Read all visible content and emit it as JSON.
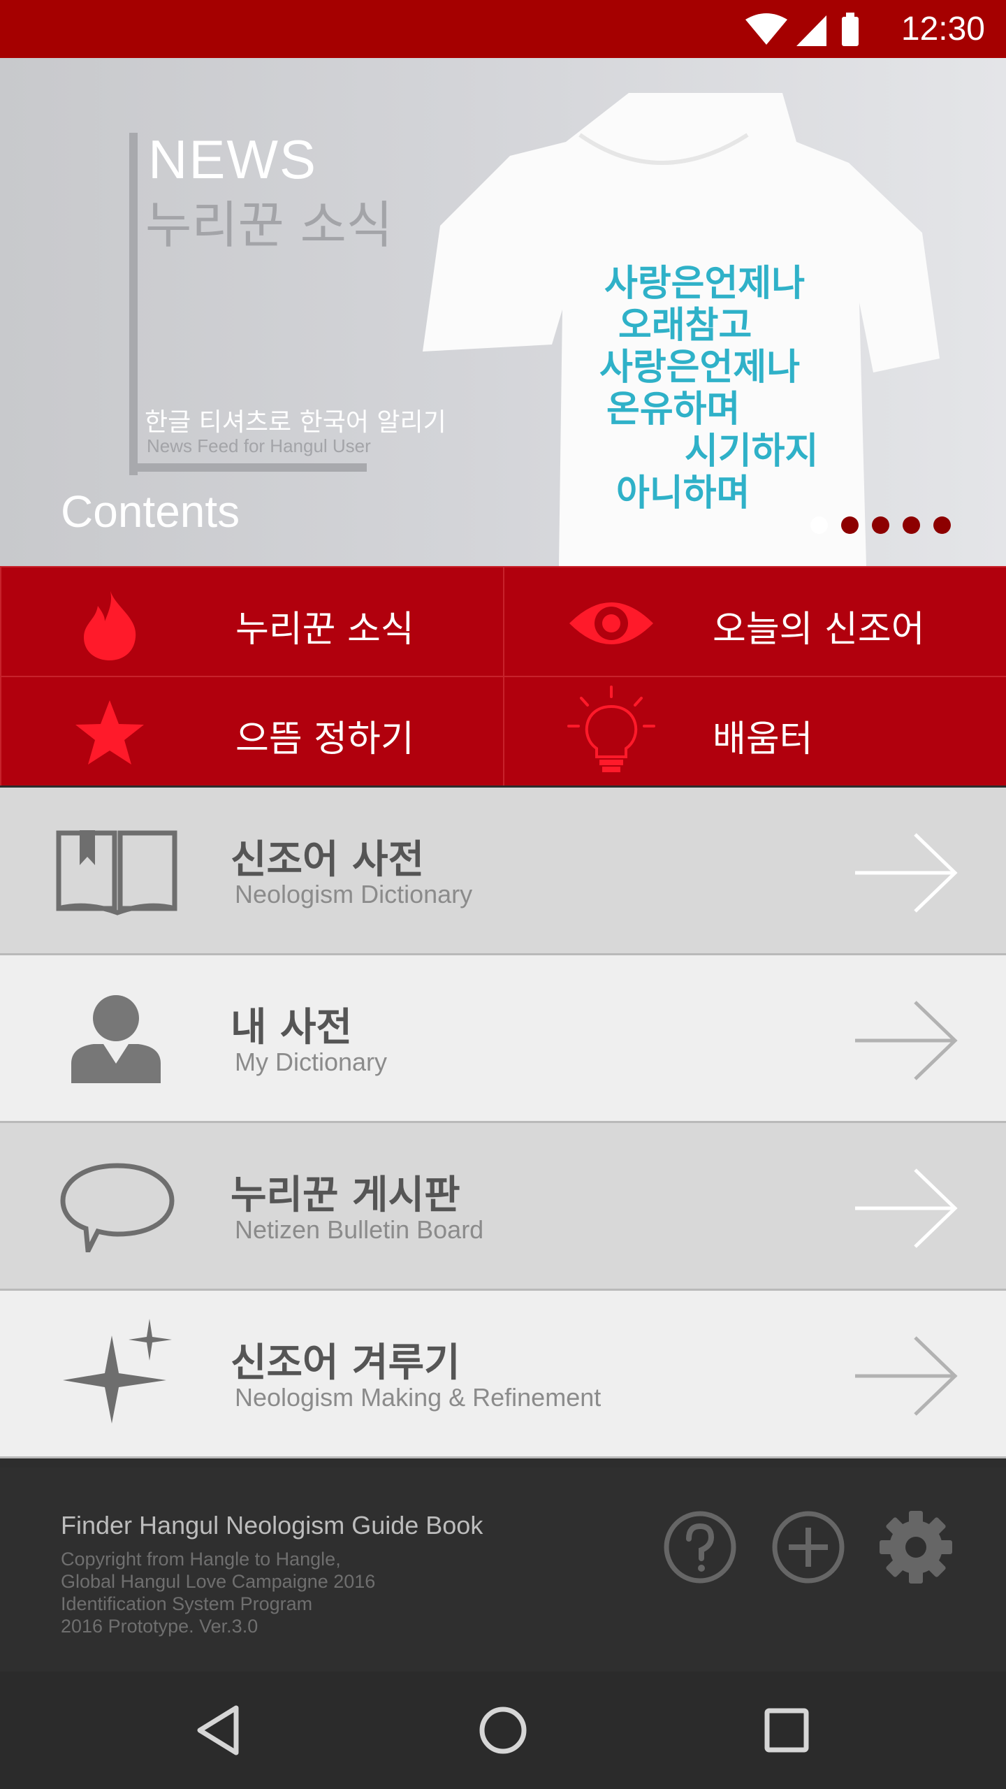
{
  "status_bar": {
    "time": "12:30",
    "icons": [
      "wifi-icon",
      "signal-icon",
      "battery-icon"
    ]
  },
  "hero": {
    "news_en": "NEWS",
    "news_ko": "누리꾼 소식",
    "caption_ko": "한글 티셔츠로 한국어 알리기",
    "caption_en": "News Feed for Hangul User",
    "section_label": "Contents",
    "carousel_dots": 5,
    "carousel_active_index": 0,
    "shirt_lettering": [
      "사랑은언제나",
      "오래참고",
      "사랑은언제나",
      "온유하며",
      "시기하지",
      "아니하며"
    ]
  },
  "quick_menu": [
    {
      "label": "누리꾼 소식",
      "icon": "flame-icon"
    },
    {
      "label": "오늘의 신조어",
      "icon": "eye-icon"
    },
    {
      "label": "으뜸 정하기",
      "icon": "star-icon"
    },
    {
      "label": "배움터",
      "icon": "lightbulb-icon"
    }
  ],
  "menu_list": [
    {
      "title_ko": "신조어 사전",
      "title_en": "Neologism Dictionary",
      "icon": "book-icon"
    },
    {
      "title_ko": "내 사전",
      "title_en": "My Dictionary",
      "icon": "person-icon"
    },
    {
      "title_ko": "누리꾼 게시판",
      "title_en": "Netizen Bulletin Board",
      "icon": "speech-bubble-icon"
    },
    {
      "title_ko": "신조어 겨루기",
      "title_en": "Neologism Making & Refinement",
      "icon": "sparkle-icon"
    }
  ],
  "footer": {
    "title": "Finder Hangul Neologism Guide Book",
    "lines": [
      "Copyright from Hangle to Hangle,",
      "Global Hangul Love Campaigne 2016",
      "Identification System Program",
      "2016 Prototype. Ver.3.0"
    ],
    "icons": [
      "help-icon",
      "add-icon",
      "settings-icon"
    ]
  },
  "nav_bar": {
    "icons": [
      "back-icon",
      "home-icon",
      "recents-icon"
    ]
  },
  "colors": {
    "brand_red": "#a50000",
    "tile_red": "#b1000d",
    "icon_red": "#ff1a2a"
  }
}
